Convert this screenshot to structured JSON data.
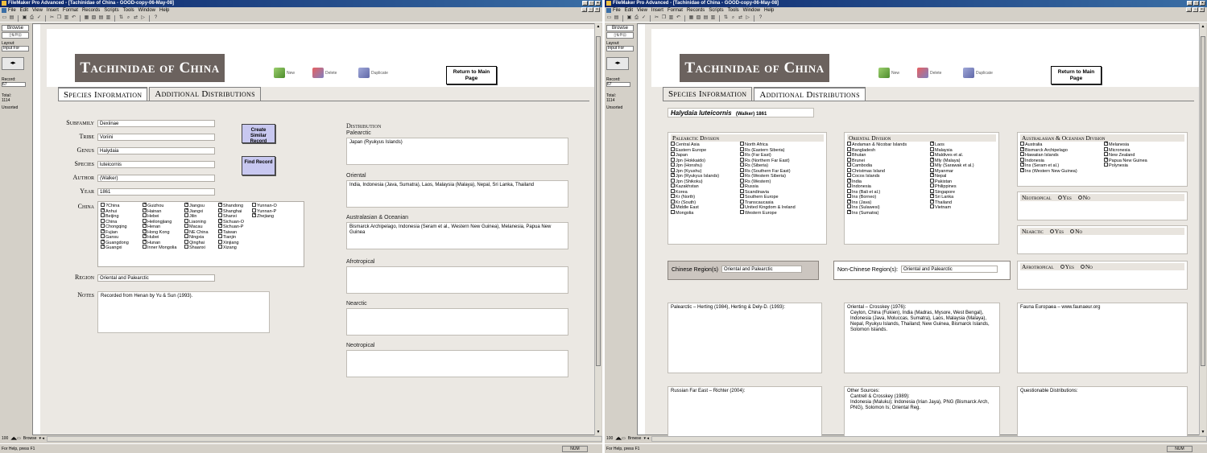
{
  "window_title": "FileMaker Pro Advanced - [Tachinidae of China - GOOD-copy-06-May-08]",
  "menu": [
    "File",
    "Edit",
    "View",
    "Insert",
    "Format",
    "Records",
    "Scripts",
    "Tools",
    "Window",
    "Help"
  ],
  "sidebar": {
    "mode": "Browse",
    "layout_label": "Layout:",
    "layout_value": "Input For",
    "record_label": "Record:",
    "record_value": "67",
    "total_label": "Total:",
    "total_value": "1114",
    "sort_status": "Unsorted"
  },
  "bottom": {
    "zoom": "100",
    "mode": "Browse",
    "status": "For Help, press F1",
    "num": "NUM"
  },
  "header": {
    "logo": "Tachinidae of China",
    "new": "New",
    "delete": "Delete",
    "duplicate": "Duplicate",
    "return": "Return to Main Page"
  },
  "tabs": [
    "Species Information",
    "Additional Distributions"
  ],
  "species": {
    "labels": {
      "subfamily": "Subfamily",
      "tribe": "Tribe",
      "genus": "Genus",
      "species": "Species",
      "author": "Author",
      "year": "Year",
      "china": "China",
      "region": "Region",
      "notes": "Notes"
    },
    "subfamily": "Dexiinae",
    "tribe": "Voriini",
    "genus": "Halydaia",
    "species": "luteicornis",
    "author": "(Walker)",
    "year": "1861",
    "region": "Oriental and Palearctic",
    "notes": "Recorded from Henan by Yu & Sun (1993).",
    "create_btn": "Create Similar Record",
    "find_btn": "Find Record",
    "china": [
      {
        "n": "?China",
        "c": false
      },
      {
        "n": "Guizhou",
        "c": true
      },
      {
        "n": "Jiangsu",
        "c": true
      },
      {
        "n": "Shandong",
        "c": true
      },
      {
        "n": "Yunnan-O",
        "c": false
      },
      {
        "n": "Anhui",
        "c": true
      },
      {
        "n": "Hainan",
        "c": true
      },
      {
        "n": "Jiangxi",
        "c": true
      },
      {
        "n": "Shanghai",
        "c": true
      },
      {
        "n": "Yunnan-P",
        "c": false
      },
      {
        "n": "Beijing",
        "c": false
      },
      {
        "n": "Hebei",
        "c": false
      },
      {
        "n": "Jilin",
        "c": false
      },
      {
        "n": "Shanxi",
        "c": false
      },
      {
        "n": "Zhejiang",
        "c": true
      },
      {
        "n": "China",
        "c": false
      },
      {
        "n": "Heilongjiang",
        "c": false
      },
      {
        "n": "Liaoning",
        "c": false
      },
      {
        "n": "Sichuan-O",
        "c": true
      },
      {
        "n": "",
        "c": null
      },
      {
        "n": "Chongqing",
        "c": false
      },
      {
        "n": "Henan",
        "c": true
      },
      {
        "n": "Macau",
        "c": false
      },
      {
        "n": "Sichuan-P",
        "c": true
      },
      {
        "n": "",
        "c": null
      },
      {
        "n": "Fujian",
        "c": true
      },
      {
        "n": "Hong Kong",
        "c": true
      },
      {
        "n": "NE China",
        "c": false
      },
      {
        "n": "Taiwan",
        "c": true
      },
      {
        "n": "",
        "c": null
      },
      {
        "n": "Gansu",
        "c": false
      },
      {
        "n": "Hubei",
        "c": true
      },
      {
        "n": "Ningxia",
        "c": false
      },
      {
        "n": "Tianjin",
        "c": false
      },
      {
        "n": "",
        "c": null
      },
      {
        "n": "Guangdong",
        "c": true
      },
      {
        "n": "Hunan",
        "c": true
      },
      {
        "n": "Qinghai",
        "c": false
      },
      {
        "n": "Xinjiang",
        "c": false
      },
      {
        "n": "",
        "c": null
      },
      {
        "n": "Guangxi",
        "c": true
      },
      {
        "n": "Inner Mongolia",
        "c": false
      },
      {
        "n": "Shaanxi",
        "c": false
      },
      {
        "n": "Xizang",
        "c": false
      },
      {
        "n": "",
        "c": null
      }
    ],
    "distribution_title": "Distribution",
    "distribution": [
      {
        "label": "Palearctic",
        "text": "Japan (Ryukyus Islands)"
      },
      {
        "label": "Oriental",
        "text": "India, Indonesia (Java, Sumatra), Laos, Malaysia (Malaya), Nepal, Sri Lanka, Thailand"
      },
      {
        "label": "Australasian & Oceanian",
        "text": "Bismarck Archipelago, Indonesia (Seram et al., Western New Guinea), Melanesia, Papua New Guinea"
      },
      {
        "label": "Afrotropical",
        "text": ""
      },
      {
        "label": "Nearctic",
        "text": ""
      },
      {
        "label": "Neotropical",
        "text": ""
      }
    ]
  },
  "additional": {
    "species_name": "Halydaia luteicornis",
    "species_author": "(Walker) 1861",
    "palearctic_title": "Palearctic Division",
    "palearctic": [
      {
        "n": "Central Asia",
        "c": false
      },
      {
        "n": "North Africa",
        "c": false
      },
      {
        "n": "Eastern Europe",
        "c": false
      },
      {
        "n": "Rs (Eastern Siberia)",
        "c": false
      },
      {
        "n": "Japan",
        "c": false
      },
      {
        "n": "Rs (Far East)",
        "c": false
      },
      {
        "n": "Jpn (Hokkaido)",
        "c": false
      },
      {
        "n": "Rs (Northern Far East)",
        "c": false
      },
      {
        "n": "Jpn (Honshu)",
        "c": false
      },
      {
        "n": "Rs (Siberia)",
        "c": false
      },
      {
        "n": "Jpn (Kyushu)",
        "c": false
      },
      {
        "n": "Rs (Southern Far East)",
        "c": false
      },
      {
        "n": "Jpn (Ryukyus Islands)",
        "c": true
      },
      {
        "n": "Rs (Western Siberia)",
        "c": false
      },
      {
        "n": "Jpn (Shikoku)",
        "c": false
      },
      {
        "n": "Rs (Western)",
        "c": false
      },
      {
        "n": "Kazakhstan",
        "c": false
      },
      {
        "n": "Russia",
        "c": false
      },
      {
        "n": "Korea",
        "c": false
      },
      {
        "n": "Scandinavia",
        "c": false
      },
      {
        "n": "Kr (North)",
        "c": false
      },
      {
        "n": "Southern Europe",
        "c": false
      },
      {
        "n": "Kr (South)",
        "c": false
      },
      {
        "n": "Transcaucasia",
        "c": false
      },
      {
        "n": "Middle East",
        "c": false
      },
      {
        "n": "United Kingdom & Ireland",
        "c": false
      },
      {
        "n": "Mongolia",
        "c": false
      },
      {
        "n": "Western Europe",
        "c": false
      }
    ],
    "oriental_title": "Oriental Division",
    "oriental": [
      {
        "n": "Andaman & Nicobar Islands",
        "c": false
      },
      {
        "n": "Laos",
        "c": true
      },
      {
        "n": "Bangladesh",
        "c": false
      },
      {
        "n": "Malaysia",
        "c": false
      },
      {
        "n": "Bhutan",
        "c": false
      },
      {
        "n": "Maldives et al.",
        "c": false
      },
      {
        "n": "Brunei",
        "c": false
      },
      {
        "n": "Mly (Malaya)",
        "c": true
      },
      {
        "n": "Cambodia",
        "c": false
      },
      {
        "n": "Mly (Sarawak et al.)",
        "c": false
      },
      {
        "n": "Christmas Island",
        "c": false
      },
      {
        "n": "Myanmar",
        "c": false
      },
      {
        "n": "Cocos Islands",
        "c": false
      },
      {
        "n": "Nepal",
        "c": true
      },
      {
        "n": "India",
        "c": true
      },
      {
        "n": "Pakistan",
        "c": false
      },
      {
        "n": "Indonesia",
        "c": false
      },
      {
        "n": "Philippines",
        "c": false
      },
      {
        "n": "Ins (Bali et al.)",
        "c": false
      },
      {
        "n": "Singapore",
        "c": false
      },
      {
        "n": "Ins (Borneo)",
        "c": false
      },
      {
        "n": "Sri Lanka",
        "c": true
      },
      {
        "n": "Ins (Java)",
        "c": true
      },
      {
        "n": "Thailand",
        "c": true
      },
      {
        "n": "Ins (Sulawesi)",
        "c": false
      },
      {
        "n": "Vietnam",
        "c": false
      },
      {
        "n": "Ins (Sumatra)",
        "c": true
      },
      {
        "n": "",
        "c": null
      }
    ],
    "austral_title": "Australasian & Oceanian Division",
    "austral": [
      {
        "n": "Australia",
        "c": false
      },
      {
        "n": "Melanesia",
        "c": true
      },
      {
        "n": "Bismarck Archipelago",
        "c": true
      },
      {
        "n": "Micronesia",
        "c": false
      },
      {
        "n": "Hawaiian Islands",
        "c": false
      },
      {
        "n": "New Zealand",
        "c": false
      },
      {
        "n": "Indonesia",
        "c": false
      },
      {
        "n": "Papua New Guinea",
        "c": true
      },
      {
        "n": "Ins (Seram et al.)",
        "c": true
      },
      {
        "n": "Polynesia",
        "c": false
      },
      {
        "n": "Ins (Western New Guinea)",
        "c": true
      },
      {
        "n": "",
        "c": null
      }
    ],
    "neotropical": "Neotropical",
    "nearctic": "Nearctic",
    "afrotropical": "Afrotropical",
    "yes": "Yes",
    "no": "No",
    "chinese_region_label": "Chinese Region(s)",
    "chinese_region": "Oriental and Palearctic",
    "nonchinese_region_label": "Non-Chinese Region(s):",
    "nonchinese_region": "Oriental and Palearctic",
    "notes": {
      "palearctic": "Palearctic – Herting (1984), Herting & Dely-D. (1993):",
      "oriental_head": "Oriental – Crosskey (1976):",
      "oriental_body": "Ceylon, China (Fukien), India (Madras, Mysore, West Bengal), Indonesia (Java, Moluccas, Sumatra), Laos, Malaysia (Malaya), Nepal, Ryukyu Islands, Thailand; New Guinea, Bismarck Islands, Solomon Islands.",
      "fauna": "Fauna Europaea – www.faunaeur.org",
      "russian": "Russian Far East – Richter (2004):",
      "other_head": "Other Sources:",
      "other_sub": "Cantrell & Crosskey (1989):",
      "other_body": "Indonesia (Maluku); Indonesia (Irian Jaya), PNG (Bismarck Arch, PNG), Solomon Is; Oriental Reg.",
      "questionable": "Questionable Distributions:"
    }
  },
  "colors": {
    "title_bar": "#0a246a",
    "logo_bg": "#6b625e",
    "button_bg": "#c8c8f0",
    "stage_bg": "#ebe8e3",
    "region_box": "#ccc6c0"
  }
}
